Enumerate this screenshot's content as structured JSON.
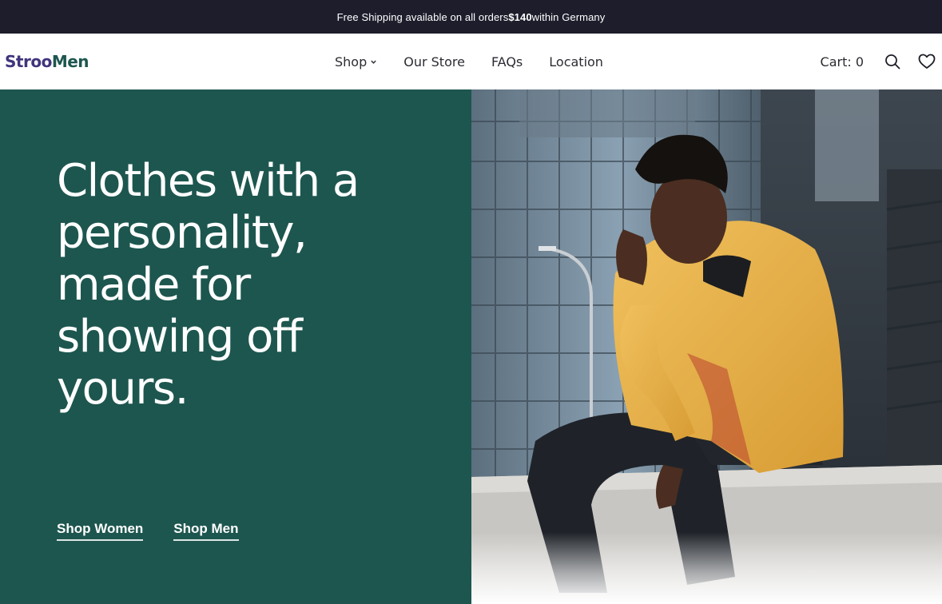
{
  "announcement": {
    "text_before": "Free Shipping available on all orders ",
    "amount": "$140",
    "text_after": " within Germany"
  },
  "header": {
    "logo_part1": "Stroo",
    "logo_part2": "Men",
    "menu": [
      {
        "label": "Shop",
        "icon": "chevron-down-icon"
      },
      {
        "label": "Our Store"
      },
      {
        "label": "FAQs"
      },
      {
        "label": "Location"
      }
    ],
    "cart_label": "Cart: 0",
    "icons": [
      "search-icon",
      "heart-icon"
    ]
  },
  "hero": {
    "headline": "Clothes with a personality, made for showing off yours.",
    "links": [
      "Shop Women",
      "Shop Men"
    ],
    "image": {
      "subject": "hero-photo"
    }
  },
  "colors": {
    "announce_bg": "#1d1d2c",
    "hero_green": "#1d564f",
    "logo_purple": "#41357d",
    "logo_green": "#1d564f",
    "jacket_yellow": "#e9b34d"
  }
}
